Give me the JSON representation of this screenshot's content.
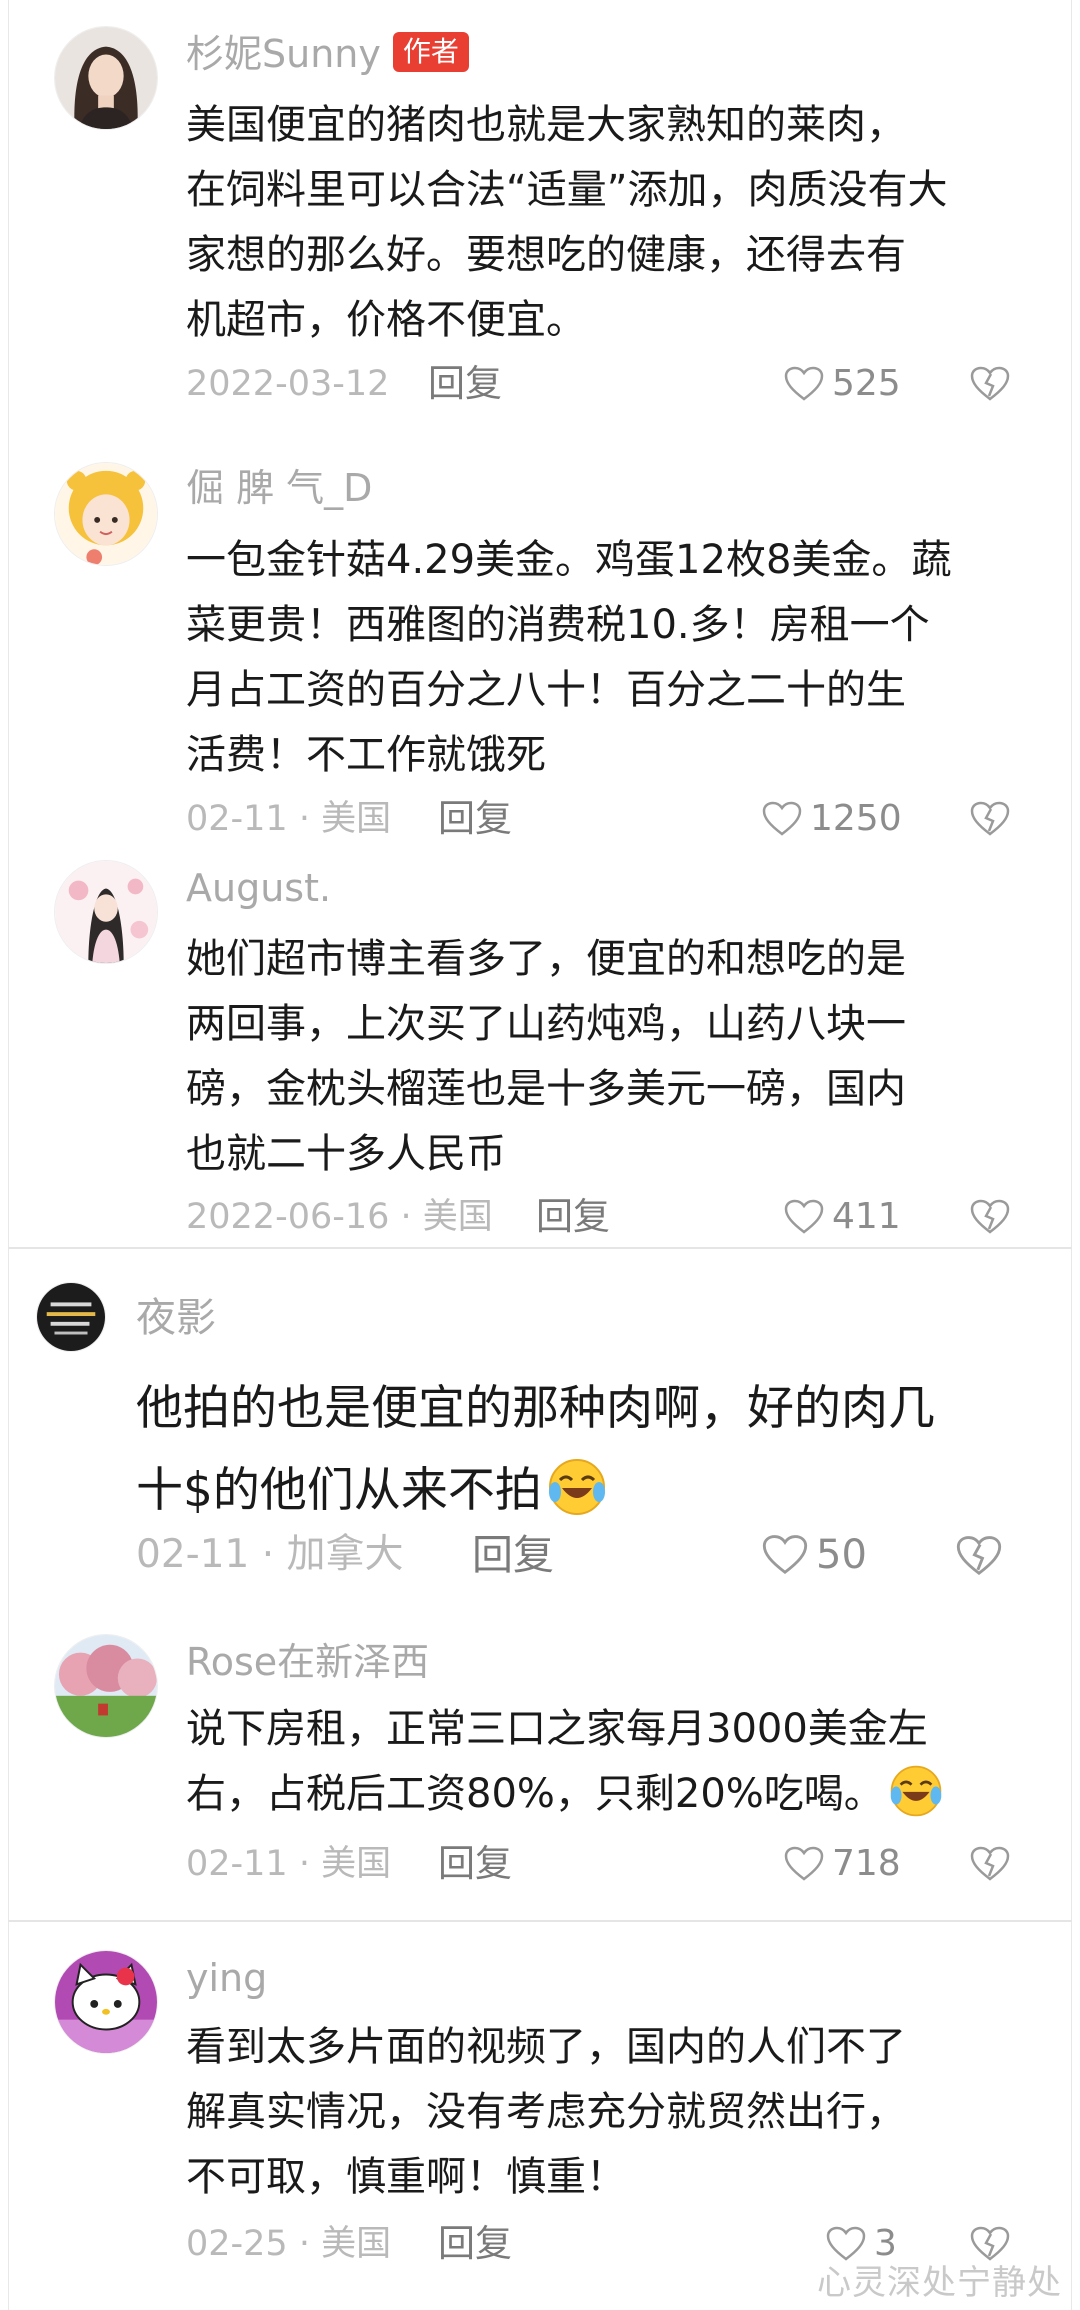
{
  "comments": [
    {
      "username": "杉妮Sunny",
      "badge": "作者",
      "lines": [
        "美国便宜的猪肉也就是大家熟知的莱肉，",
        "在饲料里可以合法“适量”添加，肉质没有大",
        "家想的那么好。要想吃的健康，还得去有",
        "机超市，价格不便宜。"
      ],
      "meta": "2022-03-12",
      "reply_label": "回复",
      "likes": "525",
      "avatar_icon": "girl-portrait-avatar"
    },
    {
      "username": "倔 脾 气_D",
      "lines": [
        "一包金针菇4.29美金。鸡蛋12枚8美金。蔬",
        "菜更贵！西雅图的消费税10.多！房租一个",
        "月占工资的百分之八十！百分之二十的生",
        "活费！不工作就饿死"
      ],
      "meta": "02-11 · 美国",
      "reply_label": "回复",
      "likes": "1250",
      "avatar_icon": "cartoon-girl-yellow-hood-avatar"
    },
    {
      "username": "August.",
      "lines": [
        "她们超市博主看多了，便宜的和想吃的是",
        "两回事，上次买了山药炖鸡，山药八块一",
        "磅，金枕头榴莲也是十多美元一磅，国内",
        "也就二十多人民币"
      ],
      "meta": "2022-06-16 · 美国",
      "reply_label": "回复",
      "likes": "411",
      "avatar_icon": "illustrated-woman-flowers-avatar"
    },
    {
      "username": "夜影",
      "lines": [
        "他拍的也是便宜的那种肉啊，好的肉几",
        "十$的他们从来不拍"
      ],
      "emoji_after_last_line": "laughing-crying-emoji",
      "meta": "02-11 · 加拿大",
      "reply_label": "回复",
      "likes": "50",
      "avatar_icon": "dark-text-avatar"
    },
    {
      "username": "Rose在新泽西",
      "lines": [
        "说下房租，正常三口之家每月3000美金左",
        "右，占税后工资80%，只剩20%吃喝。"
      ],
      "emoji_after_last_line": "laughing-crying-emoji",
      "meta": "02-11 · 美国",
      "reply_label": "回复",
      "likes": "718",
      "avatar_icon": "pink-trees-landscape-avatar"
    },
    {
      "username": "ying",
      "lines": [
        "看到太多片面的视频了，国内的人们不了",
        "解真实情况，没有考虑充分就贸然出行，",
        "不可取，慎重啊！慎重！"
      ],
      "meta": "02-25 · 美国",
      "reply_label": "回复",
      "likes": "3",
      "avatar_icon": "hello-kitty-avatar"
    }
  ],
  "watermark": "心灵深处宁静处",
  "colors": {
    "text": "#1a1a1a",
    "meta": "#b9b9b9",
    "username": "#a9a9a9",
    "badge": "#e93f33"
  }
}
